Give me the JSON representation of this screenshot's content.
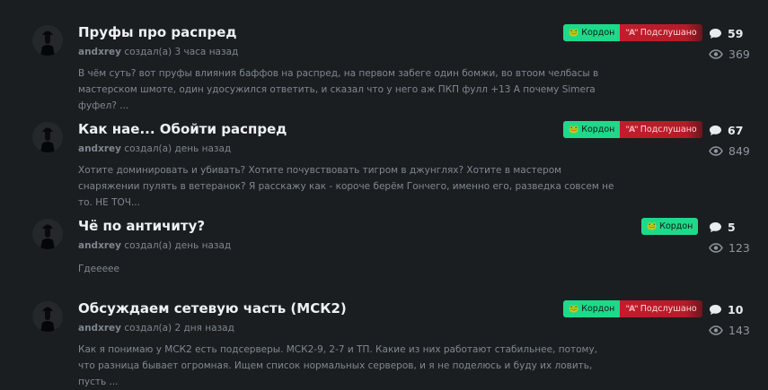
{
  "topics": [
    {
      "title": "Пруфы про распред",
      "author": "andxrey",
      "time": "создал(а) 3 часа назад",
      "excerpt": "В чём суть? вот пруфы влияния баффов на распред, на первом забеге один бомжи, во втоом челбасы в мастерском шмоте, один удосужился ответить, и сказал что у него аж ПКП фулл +13 А почему Simera фуфел? ...",
      "tag_kordon": "Кордон",
      "tag_heard": "Подслушано",
      "replies": "59",
      "views": "369"
    },
    {
      "title": "Как нае... Обойти распред",
      "author": "andxrey",
      "time": "создал(а) день назад",
      "excerpt": "Хотите доминировать и убивать? Хотите почувствовать тигром в джунглях? Хотите в мастером снаряжении пулять в ветеранок? Я расскажу как - короче берём Гончего, именно его, разведка совсем не то. НЕ ТОЧ...",
      "tag_kordon": "Кордон",
      "tag_heard": "Подслушано",
      "replies": "67",
      "views": "849"
    },
    {
      "title": "Чё по античиту?",
      "author": "andxrey",
      "time": "создал(а) день назад",
      "excerpt": "Гдеееее",
      "tag_kordon": "Кордон",
      "replies": "5",
      "views": "123"
    },
    {
      "title": "Обсуждаем сетевую часть (МСК2)",
      "author": "andxrey",
      "time": "создал(а) 2 дня назад",
      "excerpt": "Как я понимаю у МСК2 есть подсерверы. МСК2-9, 2-7 и ТП. Какие из них работают стабильнее, потому, что разница бывает огромная. Ищем список нормальных серверов, и я не поделюсь и буду их ловить, пусть ...",
      "tag_kordon": "Кордон",
      "tag_heard": "Подслушано",
      "replies": "10",
      "views": "143"
    }
  ],
  "icons": {
    "kordon_tag": "frog-icon",
    "heard_tag": "quote-icon",
    "replies": "speech-bubble-icon",
    "views": "eye-icon"
  },
  "colors": {
    "background": "#1b1e21",
    "kordon_tag": "#1fd98a",
    "heard_tag": "#c21d2c"
  }
}
